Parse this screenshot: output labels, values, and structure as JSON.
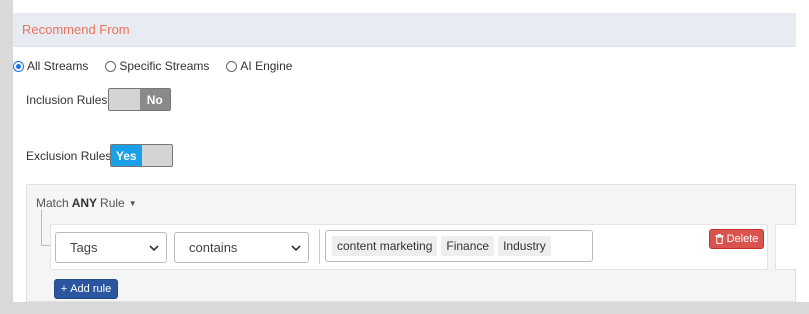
{
  "section": {
    "title": "Recommend From"
  },
  "source_options": [
    {
      "label": "All Streams",
      "checked": true
    },
    {
      "label": "Specific Streams",
      "checked": false
    },
    {
      "label": "AI Engine",
      "checked": false
    }
  ],
  "inclusion": {
    "label": "Inclusion Rules",
    "toggle_text": "No",
    "enabled": false
  },
  "exclusion": {
    "label": "Exclusion Rules",
    "toggle_text": "Yes",
    "enabled": true
  },
  "rules": {
    "match_prefix": "Match",
    "match_mode": "ANY",
    "match_suffix": "Rule",
    "rule": {
      "field": "Tags",
      "operator": "contains",
      "tags": [
        "content marketing",
        "Finance",
        "Industry"
      ]
    },
    "delete_label": "Delete",
    "add_label": "Add rule"
  },
  "colors": {
    "title": "#e8735a",
    "toggle_yes": "#1aa0e6",
    "toggle_no": "#8a8a8a",
    "delete": "#d9534f",
    "add": "#2c57a0",
    "radio_checked": "#1a73e8"
  },
  "icons": {
    "delete": "trash-icon",
    "add": "plus-icon",
    "select": "chevron-down-icon",
    "match": "caret-down-icon"
  }
}
